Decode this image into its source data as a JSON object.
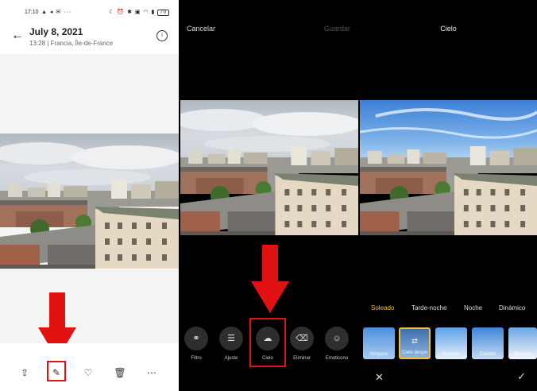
{
  "panel1": {
    "status": {
      "time": "17:10",
      "battery": "70"
    },
    "header": {
      "date": "July 8, 2021",
      "location": "13:28 | Francia, Île-de-France"
    },
    "icons": {
      "back": "back-arrow-icon",
      "info": "info-icon",
      "share": "share-icon",
      "edit": "edit-icon",
      "favorite": "heart-icon",
      "delete": "trash-icon",
      "more": "more-icon"
    }
  },
  "panel2": {
    "cancel": "Cancelar",
    "save": "Guardar",
    "tools": [
      {
        "label": "Filtro",
        "icon": "filter-icon"
      },
      {
        "label": "Ajuste",
        "icon": "adjust-icon"
      },
      {
        "label": "Cielo",
        "icon": "cloud-icon"
      },
      {
        "label": "Eliminar",
        "icon": "eraser-icon"
      },
      {
        "label": "Emoticono",
        "icon": "emoji-icon"
      }
    ]
  },
  "panel3": {
    "title": "Cielo",
    "tabs": [
      "Soleado",
      "Tarde-noche",
      "Noche",
      "Dinámico"
    ],
    "active_tab": "Soleado",
    "thumbnails": [
      "Ninguno",
      "Cielo despe",
      "Soleado",
      "Celeste",
      "Nublado"
    ],
    "selected_thumbnail": "Cielo despe",
    "cancel_icon": "close-icon",
    "confirm_icon": "check-icon"
  },
  "colors": {
    "highlight": "#e31212",
    "accent": "#f2c230"
  }
}
